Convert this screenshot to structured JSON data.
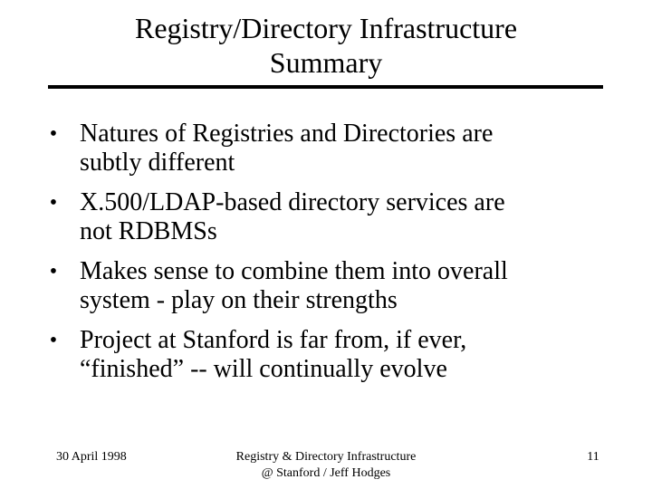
{
  "slide": {
    "title_line1": "Registry/Directory Infrastructure",
    "title_line2": "Summary",
    "bullet_glyph": "•",
    "bullets": [
      {
        "line1": "Natures of Registries and Directories are",
        "line2": "subtly different"
      },
      {
        "line1": "X.500/LDAP-based directory services are",
        "line2": "not RDBMSs"
      },
      {
        "line1": "Makes sense to combine them into overall",
        "line2": "system - play on their strengths"
      },
      {
        "line1": "Project at Stanford is far from, if ever,",
        "line2": "“finished” -- will continually evolve"
      }
    ]
  },
  "footer": {
    "date": "30 April 1998",
    "center_line1": "Registry & Directory Infrastructure",
    "center_line2": "@ Stanford / Jeff Hodges",
    "page_number": "11"
  }
}
